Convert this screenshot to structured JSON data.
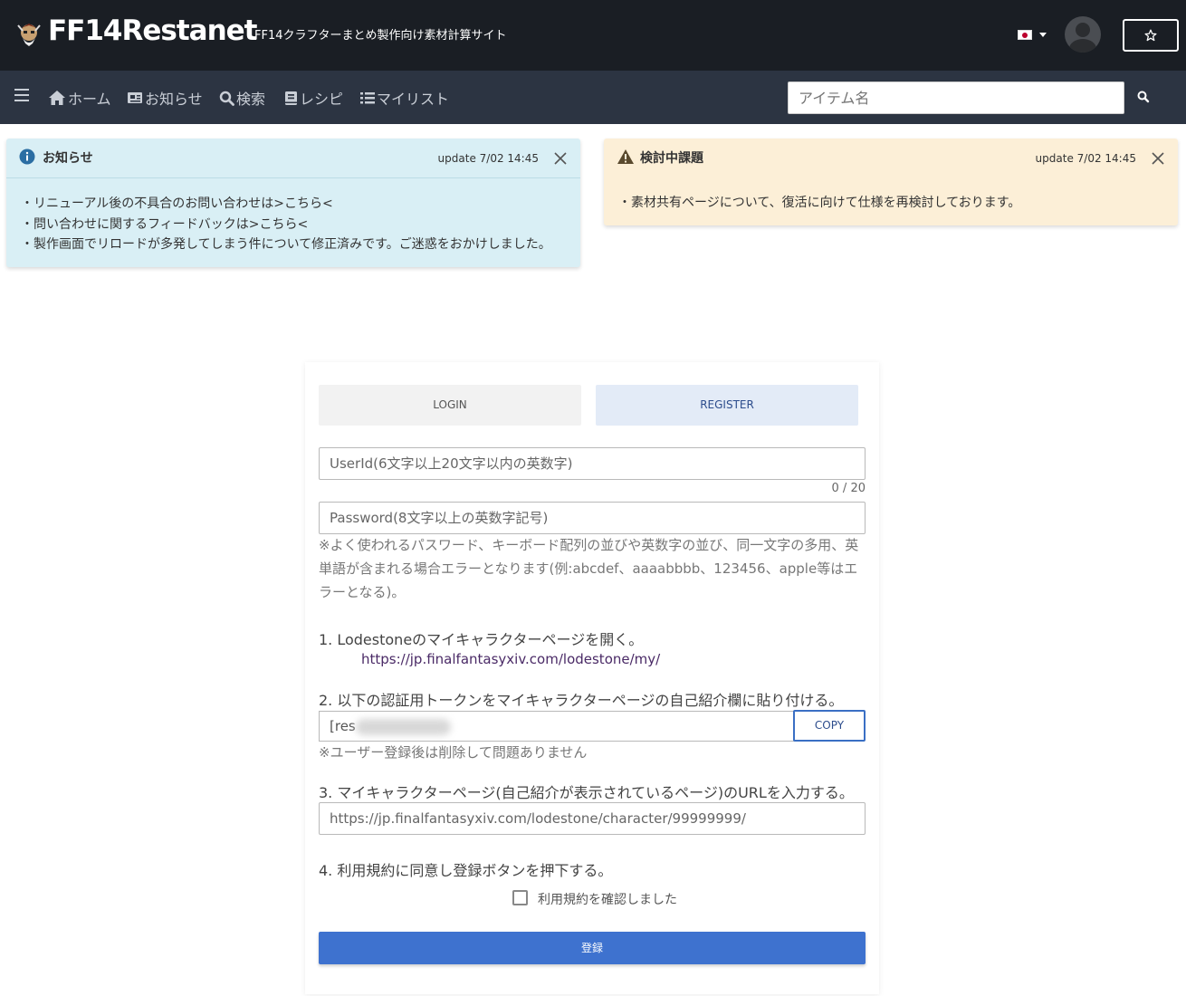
{
  "header": {
    "brand": "FF14Restanet",
    "tagline": "FF14クラフターまとめ製作向け素材計算サイト",
    "language_flag": "japan-flag-icon",
    "favorite_icon": "star-icon"
  },
  "nav": {
    "menu_icon": "menu-icon",
    "items": [
      {
        "label": "ホーム",
        "icon": "home-icon"
      },
      {
        "label": "お知らせ",
        "icon": "newspaper-icon"
      },
      {
        "label": "検索",
        "icon": "search-icon"
      },
      {
        "label": "レシピ",
        "icon": "book-icon"
      },
      {
        "label": "マイリスト",
        "icon": "list-icon"
      }
    ],
    "search_placeholder": "アイテム名"
  },
  "alerts": {
    "info": {
      "title": "お知らせ",
      "date": "update 7/02 14:45",
      "lines": [
        "・リニューアル後の不具合のお問い合わせは>こちら<",
        "・問い合わせに関するフィードバックは>こちら<",
        "・製作画面でリロードが多発してしまう件について修正済みです。ご迷惑をおかけしました。"
      ]
    },
    "warning": {
      "title": "検討中課題",
      "date": "update 7/02 14:45",
      "lines": [
        "・素材共有ページについて、復活に向けて仕様を再検討しております。"
      ]
    }
  },
  "form": {
    "tabs": {
      "login": "LOGIN",
      "register": "REGISTER"
    },
    "userid_placeholder": "UserId(6文字以上20文字以内の英数字)",
    "userid_counter": "0 / 20",
    "password_placeholder": "Password(8文字以上の英数字記号)",
    "password_hint": "※よく使われるパスワード、キーボード配列の並びや英数字の並び、同一文字の多用、英単語が含まれる場合エラーとなります(例:abcdef、aaaabbbb、123456、apple等はエラーとなる)。",
    "step1": "1. Lodestoneのマイキャラクターページを開く。",
    "step1_link": "https://jp.finalfantasyxiv.com/lodestone/my/",
    "step2": "2. 以下の認証用トークンをマイキャラクターページの自己紹介欄に貼り付ける。",
    "token_prefix": "[res",
    "copy_label": "COPY",
    "token_note": "※ユーザー登録後は削除して問題ありません",
    "step3": "3. マイキャラクターページ(自己紹介が表示されているページ)のURLを入力する。",
    "url_placeholder": "https://jp.finalfantasyxiv.com/lodestone/character/99999999/",
    "step4": "4. 利用規約に同意し登録ボタンを押下する。",
    "terms_label": "利用規約を確認しました",
    "submit_label": "登録"
  }
}
